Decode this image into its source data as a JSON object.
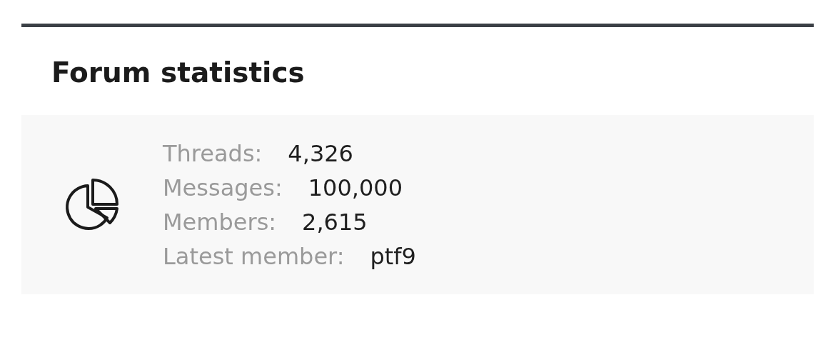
{
  "title": "Forum statistics",
  "stats": [
    {
      "label": "Threads:",
      "value": "4,326"
    },
    {
      "label": "Messages:",
      "value": "100,000"
    },
    {
      "label": "Members:",
      "value": "2,615"
    },
    {
      "label": "Latest member:",
      "value": "ptf9"
    }
  ]
}
